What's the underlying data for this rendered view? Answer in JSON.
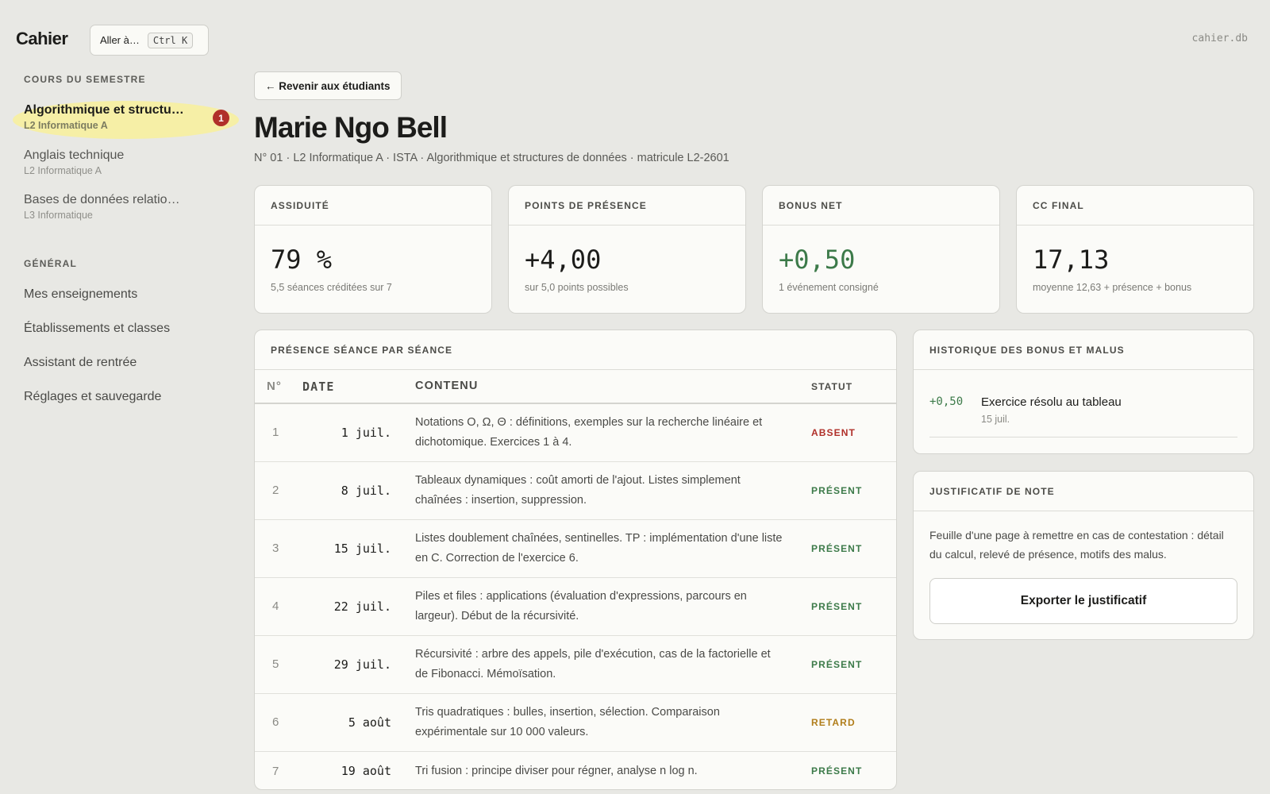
{
  "app": {
    "brand": "Cahier",
    "goto_label": "Aller à…",
    "goto_shortcut": "Ctrl K",
    "db_name": "cahier.db"
  },
  "sidebar": {
    "courses_heading": "COURS DU SEMESTRE",
    "courses": [
      {
        "title": "Algorithmique et structu…",
        "subtitle": "L2 Informatique A",
        "badge": "1",
        "active": true
      },
      {
        "title": "Anglais technique",
        "subtitle": "L2 Informatique A"
      },
      {
        "title": "Bases de données relatio…",
        "subtitle": "L3 Informatique"
      }
    ],
    "general_heading": "GÉNÉRAL",
    "nav": [
      "Mes enseignements",
      "Établissements et classes",
      "Assistant de rentrée",
      "Réglages et sauvegarde"
    ]
  },
  "main": {
    "back_label": "← Revenir aux étudiants",
    "student_name": "Marie Ngo Bell",
    "student_meta": "N° 01 · L2 Informatique A · ISTA · Algorithmique et structures de données · matricule L2-2601",
    "stats": [
      {
        "label": "ASSIDUITÉ",
        "value": "79 %",
        "sub": "5,5 séances créditées sur 7"
      },
      {
        "label": "POINTS DE PRÉSENCE",
        "value": "+4,00",
        "sub": "sur 5,0 points possibles"
      },
      {
        "label": "BONUS NET",
        "value": "+0,50",
        "sub": "1 événement consigné",
        "color": "#3c7a49"
      },
      {
        "label": "CC FINAL",
        "value": "17,13",
        "sub": "moyenne 12,63 + présence + bonus"
      }
    ],
    "attendance": {
      "heading": "PRÉSENCE SÉANCE PAR SÉANCE",
      "columns": [
        "N°",
        "DATE",
        "CONTENU",
        "STATUT"
      ],
      "rows": [
        {
          "n": "1",
          "date": "1 juil.",
          "content": "Notations O, Ω, Θ : définitions, exemples sur la recherche linéaire et dichotomique. Exercices 1 à 4.",
          "status": "ABSENT"
        },
        {
          "n": "2",
          "date": "8 juil.",
          "content": "Tableaux dynamiques : coût amorti de l'ajout. Listes simplement chaînées : insertion, suppression.",
          "status": "PRÉSENT"
        },
        {
          "n": "3",
          "date": "15 juil.",
          "content": "Listes doublement chaînées, sentinelles. TP : implémentation d'une liste en C. Correction de l'exercice 6.",
          "status": "PRÉSENT"
        },
        {
          "n": "4",
          "date": "22 juil.",
          "content": "Piles et files : applications (évaluation d'expressions, parcours en largeur). Début de la récursivité.",
          "status": "PRÉSENT"
        },
        {
          "n": "5",
          "date": "29 juil.",
          "content": "Récursivité : arbre des appels, pile d'exécution, cas de la factorielle et de Fibonacci. Mémoïsation.",
          "status": "PRÉSENT"
        },
        {
          "n": "6",
          "date": "5 août",
          "content": "Tris quadratiques : bulles, insertion, sélection. Comparaison expérimentale sur 10 000 valeurs.",
          "status": "RETARD"
        },
        {
          "n": "7",
          "date": "19 août",
          "content": "Tri fusion : principe diviser pour régner, analyse n log n.",
          "status": "PRÉSENT"
        }
      ]
    },
    "history": {
      "heading": "HISTORIQUE DES BONUS ET MALUS",
      "items": [
        {
          "amount": "+0,50",
          "label": "Exercice résolu au tableau",
          "date": "15 juil."
        }
      ]
    },
    "justificatif": {
      "heading": "JUSTIFICATIF DE NOTE",
      "text": "Feuille d'une page à remettre en cas de contestation : détail du calcul, relevé de présence, motifs des malus.",
      "button": "Exporter le justificatif"
    }
  },
  "colors": {
    "absent": "#b0302a",
    "present": "#3c7a49",
    "retard": "#b07d1a",
    "highlight": "#f6efa6"
  }
}
